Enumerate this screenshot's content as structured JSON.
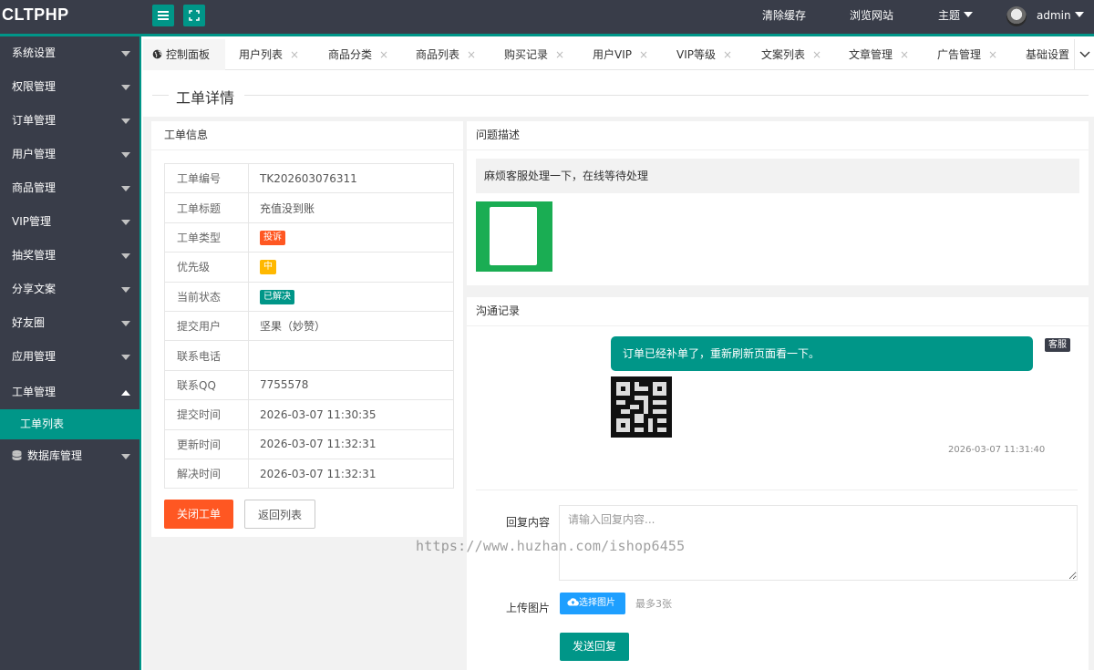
{
  "app": {
    "logo": "CLTPHP"
  },
  "header": {
    "clear_cache": "清除缓存",
    "browse_site": "浏览网站",
    "theme": "主题",
    "user": "admin"
  },
  "sidebar": {
    "items": [
      {
        "label": "系统设置"
      },
      {
        "label": "权限管理"
      },
      {
        "label": "订单管理"
      },
      {
        "label": "用户管理"
      },
      {
        "label": "商品管理"
      },
      {
        "label": "VIP管理"
      },
      {
        "label": "抽奖管理"
      },
      {
        "label": "分享文案"
      },
      {
        "label": "好友圈"
      },
      {
        "label": "应用管理"
      },
      {
        "label": "工单管理",
        "expanded": true
      },
      {
        "label": "数据库管理"
      }
    ],
    "sub_active": "工单列表"
  },
  "tabs": {
    "items": [
      {
        "label": "控制面板"
      },
      {
        "label": "用户列表"
      },
      {
        "label": "商品分类"
      },
      {
        "label": "商品列表"
      },
      {
        "label": "购买记录"
      },
      {
        "label": "用户VIP"
      },
      {
        "label": "VIP等级"
      },
      {
        "label": "文案列表"
      },
      {
        "label": "文章管理"
      },
      {
        "label": "广告管理"
      },
      {
        "label": "基础设置"
      }
    ],
    "close_glyph": "×"
  },
  "page": {
    "title": "工单详情"
  },
  "ticket_info": {
    "heading": "工单信息",
    "rows": [
      {
        "key": "工单编号",
        "value": "TK202603076311"
      },
      {
        "key": "工单标题",
        "value": "充值没到账"
      },
      {
        "key": "工单类型",
        "value": "投诉"
      },
      {
        "key": "优先级",
        "value": "中"
      },
      {
        "key": "当前状态",
        "value": "已解决"
      },
      {
        "key": "提交用户",
        "value": "坚果（妙赞）"
      },
      {
        "key": "联系电话",
        "value": ""
      },
      {
        "key": "联系QQ",
        "value": "7755578"
      },
      {
        "key": "提交时间",
        "value": "2026-03-07 11:30:35"
      },
      {
        "key": "更新时间",
        "value": "2026-03-07 11:32:31"
      },
      {
        "key": "解决时间",
        "value": "2026-03-07 11:32:31"
      }
    ],
    "badge_colors": {
      "type": "#ff5722",
      "priority": "#ffb800",
      "status": "#009688"
    },
    "close_button": "关闭工单",
    "back_button": "返回列表"
  },
  "problem": {
    "heading": "问题描述",
    "text": "麻烦客服处理一下，在线等待处理"
  },
  "communication": {
    "heading": "沟通记录",
    "message": "订单已经补单了，重新刷新页面看一下。",
    "sender_tag": "客服",
    "time": "2026-03-07 11:31:40"
  },
  "reply_form": {
    "content_label": "回复内容",
    "content_placeholder": "请输入回复内容...",
    "upload_label": "上传图片",
    "upload_button": "选择图片",
    "upload_tip": "最多3张",
    "send_button": "发送回复"
  },
  "watermark": "https://www.huzhan.com/ishop6455",
  "colors": {
    "accent": "#009688",
    "dark": "#393d49",
    "danger": "#ff5722",
    "info": "#1e9fff"
  }
}
